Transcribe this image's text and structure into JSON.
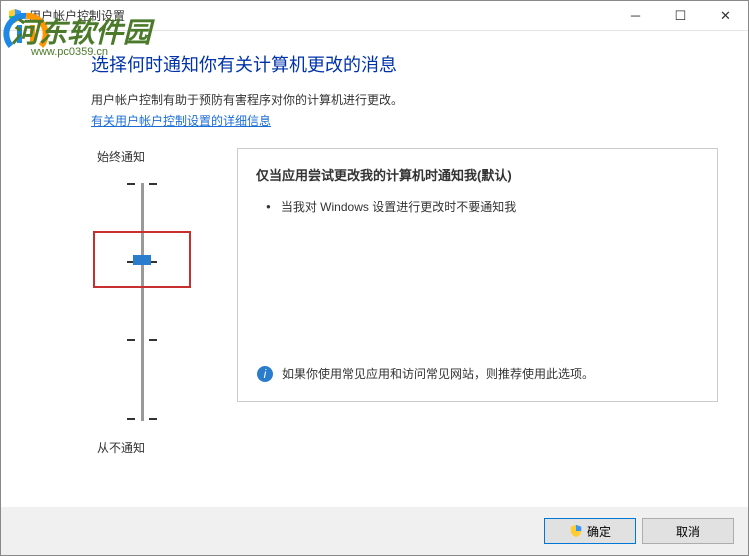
{
  "titlebar": {
    "title": "用户帐户控制设置"
  },
  "watermark": {
    "main": "河东软件园",
    "sub": "www.pc0359.cn"
  },
  "heading": "选择何时通知你有关计算机更改的消息",
  "subtext": "用户帐户控制有助于预防有害程序对你的计算机进行更改。",
  "link": "有关用户帐户控制设置的详细信息",
  "slider": {
    "top_label": "始终通知",
    "bottom_label": "从不通知"
  },
  "desc": {
    "title": "仅当应用尝试更改我的计算机时通知我(默认)",
    "bullet": "当我对 Windows 设置进行更改时不要通知我",
    "info": "如果你使用常见应用和访问常见网站，则推荐使用此选项。"
  },
  "buttons": {
    "ok": "确定",
    "cancel": "取消"
  }
}
